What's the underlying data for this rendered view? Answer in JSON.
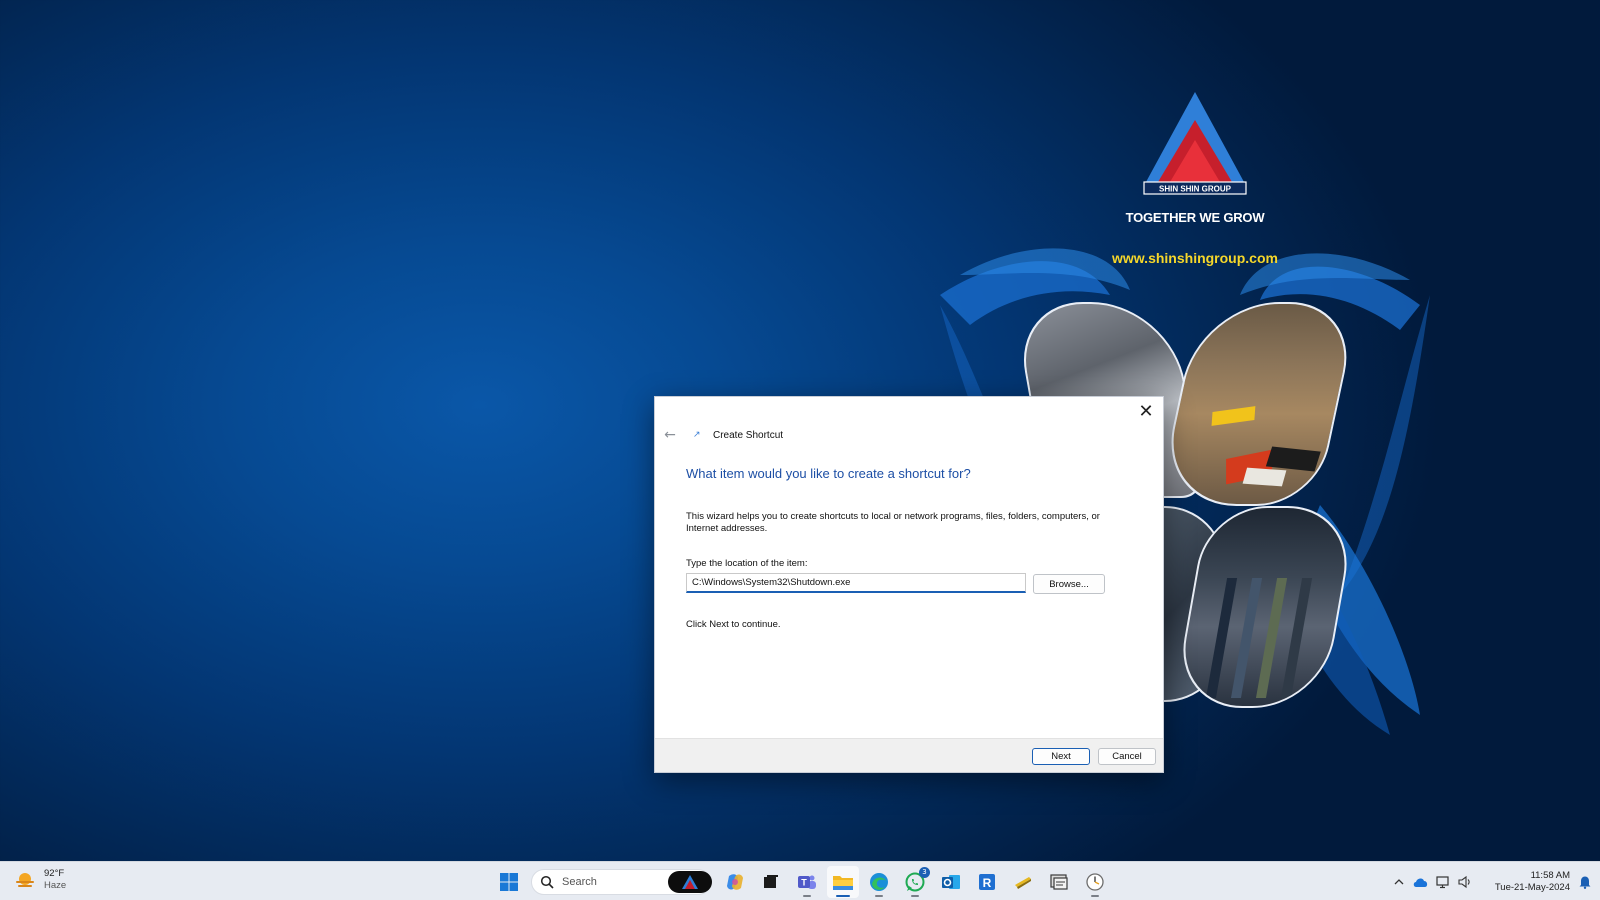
{
  "branding": {
    "logo_text": "SHIN SHIN GROUP",
    "tagline": "TOGETHER WE GROW",
    "website": "www.shinshingroup.com"
  },
  "dialog": {
    "window_title": "Create Shortcut",
    "heading": "What item would you like to create a shortcut for?",
    "description": "This wizard helps you to create shortcuts to local or network programs, files, folders, computers, or Internet addresses.",
    "field_label": "Type the location of the item:",
    "location_value": "C:\\Windows\\System32\\Shutdown.exe",
    "browse_label": "Browse...",
    "continue_note": "Click Next to continue.",
    "next_label": "Next",
    "cancel_label": "Cancel",
    "close_glyph": "✕",
    "back_glyph": "←"
  },
  "taskbar": {
    "weather": {
      "temp": "92°F",
      "condition": "Haze",
      "icon": "sun-haze-icon"
    },
    "search_placeholder": "Search",
    "apps": [
      {
        "name": "copilot",
        "icon": "copilot-icon"
      },
      {
        "name": "task-view",
        "icon": "task-view-icon"
      },
      {
        "name": "teams",
        "icon": "teams-icon"
      },
      {
        "name": "file-explorer",
        "icon": "folder-icon",
        "active": true
      },
      {
        "name": "edge",
        "icon": "edge-icon"
      },
      {
        "name": "whatsapp",
        "icon": "whatsapp-icon",
        "badge": "3"
      },
      {
        "name": "outlook",
        "icon": "outlook-icon"
      },
      {
        "name": "remote-desktop",
        "icon": "remote-desktop-icon"
      },
      {
        "name": "tool",
        "icon": "tool-icon"
      },
      {
        "name": "control-panel",
        "icon": "control-panel-icon"
      },
      {
        "name": "clock-app",
        "icon": "clock-app-icon"
      }
    ],
    "tray": {
      "chevron": "^",
      "time": "11:58 AM",
      "date": "Tue-21-May-2024"
    }
  },
  "colors": {
    "desktop_bg": "#033673",
    "accent": "#1a5fb4",
    "heading_blue": "#1d4fa5",
    "website_yellow": "#f6d72a"
  }
}
